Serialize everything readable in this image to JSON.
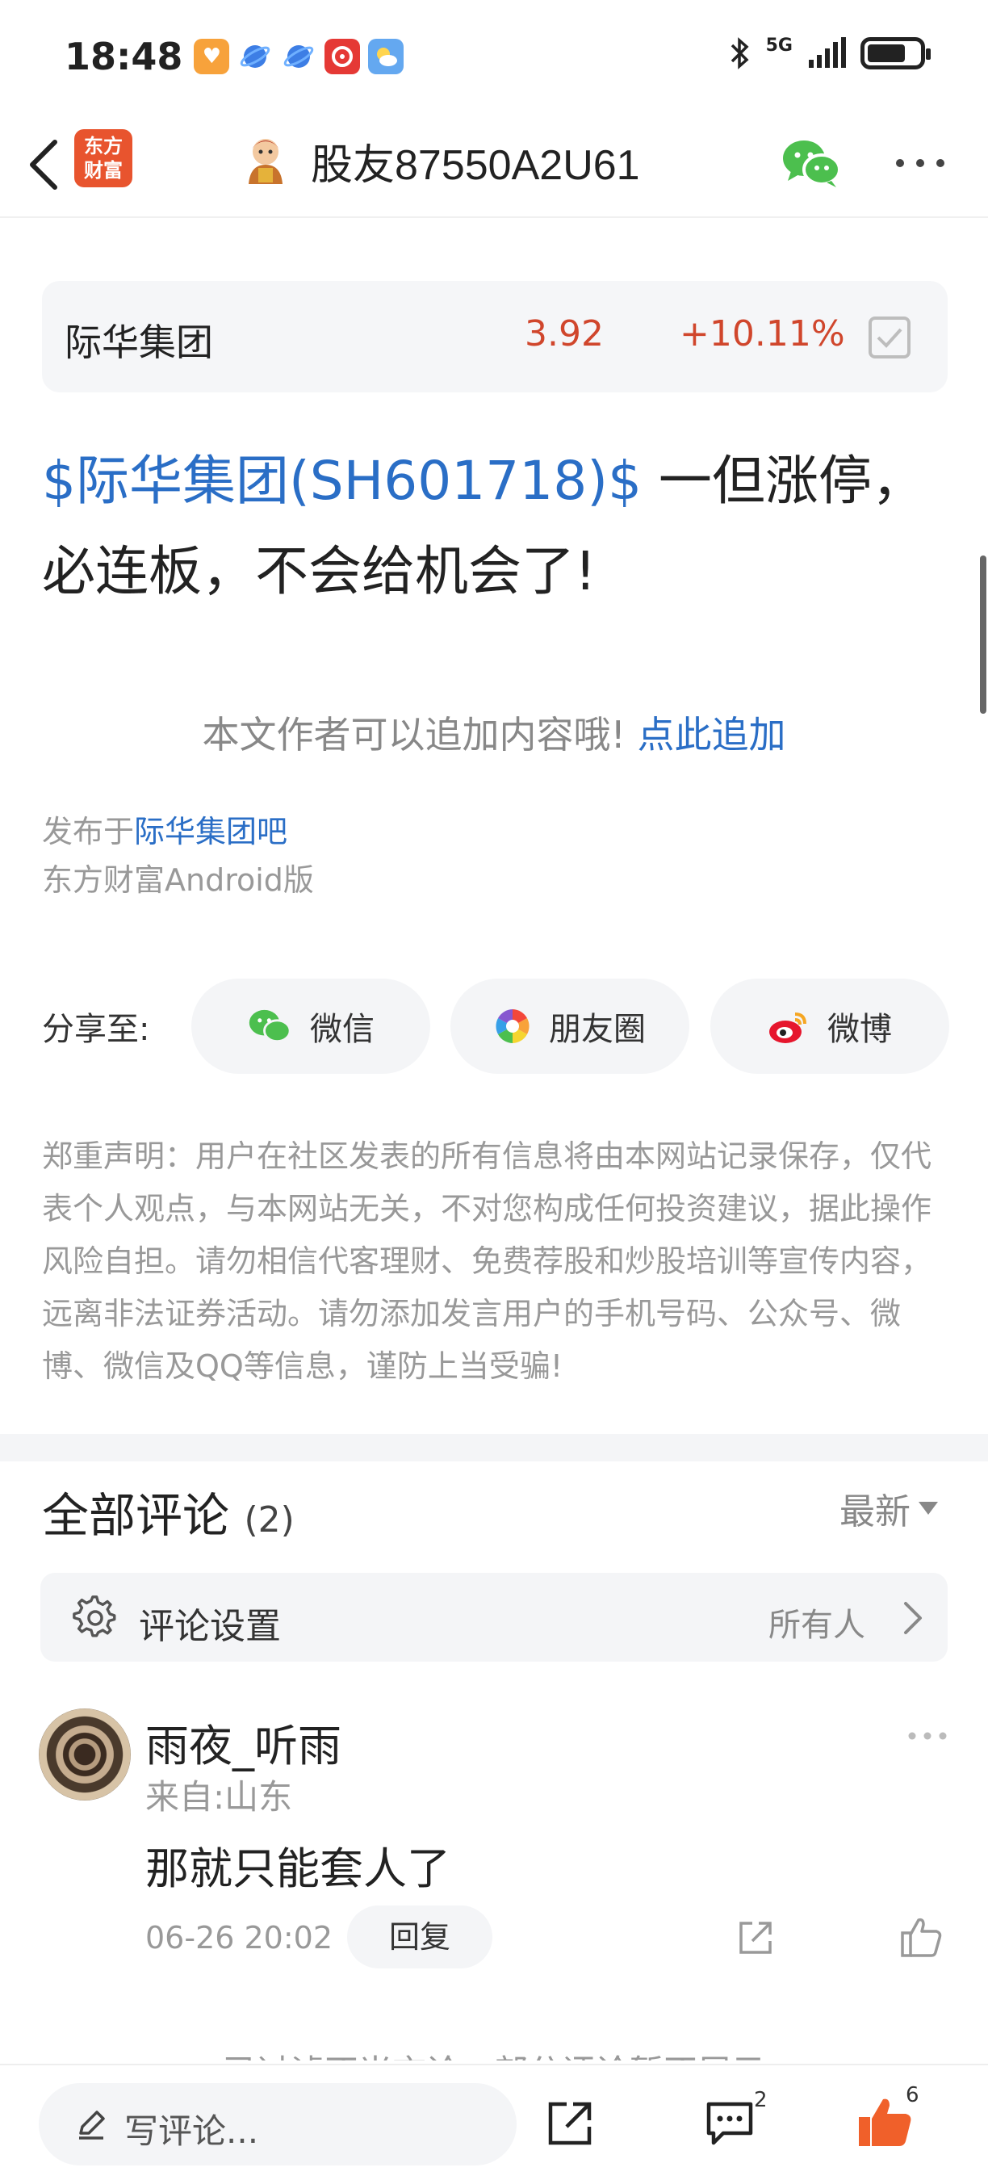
{
  "status_bar": {
    "time": "18:48",
    "network": "5G"
  },
  "header": {
    "back_icon": "chevron-left-icon",
    "app_logo_text_line1": "东方",
    "app_logo_text_line2": "财富",
    "title": "股友87550A2U61",
    "wechat_icon": "wechat-icon",
    "more_icon": "more-icon"
  },
  "stock_card": {
    "name": "际华集团",
    "price": "3.92",
    "change": "+10.11%"
  },
  "post": {
    "tag": "$际华集团(SH601718)$",
    "text": " 一但涨停，必连板，不会给机会了!"
  },
  "append": {
    "prompt": "本文作者可以追加内容哦! ",
    "link": "点此追加"
  },
  "meta": {
    "published_prefix": "发布于",
    "forum": "际华集团吧",
    "client": "东方财富Android版"
  },
  "share": {
    "label": "分享至:",
    "options": [
      "微信",
      "朋友圈",
      "微博"
    ]
  },
  "disclaimer": "郑重声明：用户在社区发表的所有信息将由本网站记录保存，仅代表个人观点，与本网站无关，不对您构成任何投资建议，据此操作风险自担。请勿相信代客理财、免费荐股和炒股培训等宣传内容，远离非法证券活动。请勿添加发言用户的手机号码、公众号、微博、微信及QQ等信息，谨防上当受骗!",
  "comments": {
    "title": "全部评论",
    "count": "(2)",
    "sort": "最新",
    "settings_label": "评论设置",
    "settings_value": "所有人",
    "items": [
      {
        "name": "雨夜_听雨",
        "location": "来自:山东",
        "text": "那就只能套人了",
        "time": "06-26 20:02",
        "reply": "回复"
      }
    ],
    "filtered_note": "已过滤不当言论，部分评论暂不展示"
  },
  "bottom_bar": {
    "write_placeholder": "写评论...",
    "comment_count": "2",
    "like_count": "6"
  },
  "colors": {
    "accent_blue": "#2a6ec6",
    "price_red": "#d0462c",
    "like_orange": "#f0602a",
    "wechat_green": "#4cbf4e"
  }
}
